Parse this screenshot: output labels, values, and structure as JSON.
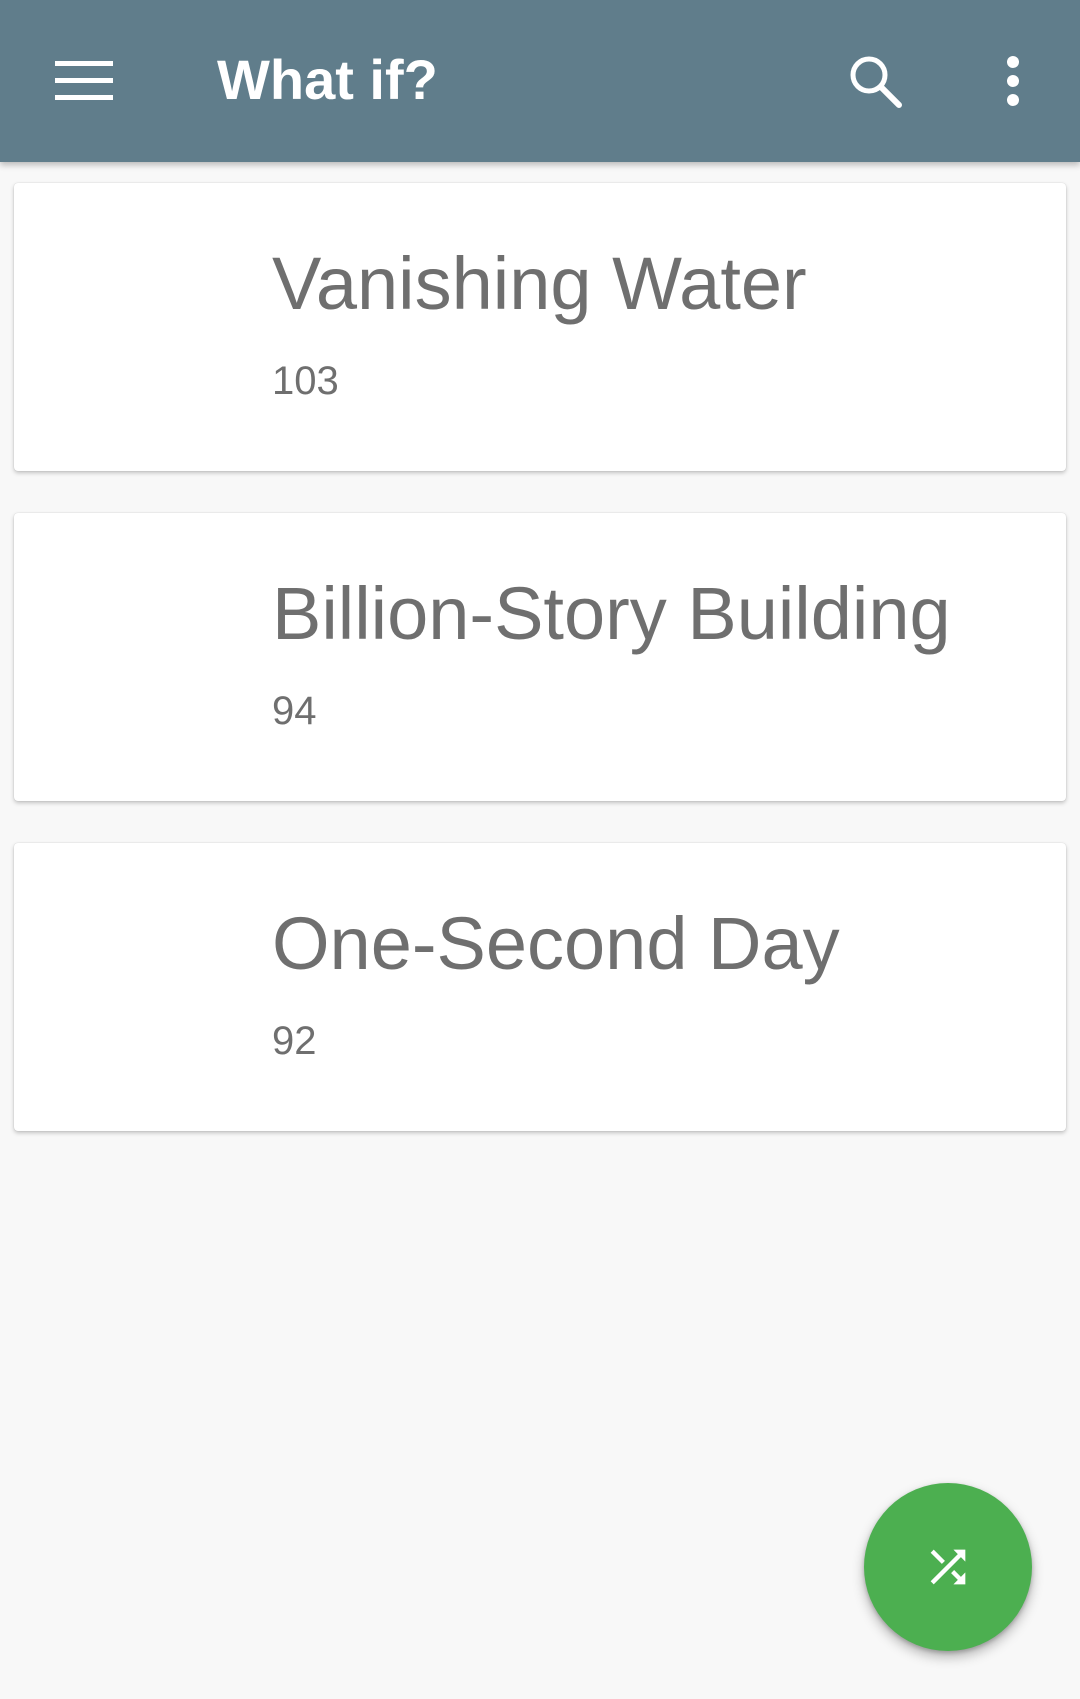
{
  "app_bar": {
    "title": "What if?",
    "menu_icon": "hamburger-menu-icon",
    "search_icon": "search-icon",
    "overflow_icon": "more-vert-icon",
    "background_color": "#607d8b"
  },
  "articles": [
    {
      "title": "Vanishing Water",
      "number": "103"
    },
    {
      "title": "Billion-Story Building",
      "number": "94"
    },
    {
      "title": "One-Second Day",
      "number": "92"
    }
  ],
  "fab": {
    "icon": "shuffle-icon",
    "color": "#4caf50"
  }
}
